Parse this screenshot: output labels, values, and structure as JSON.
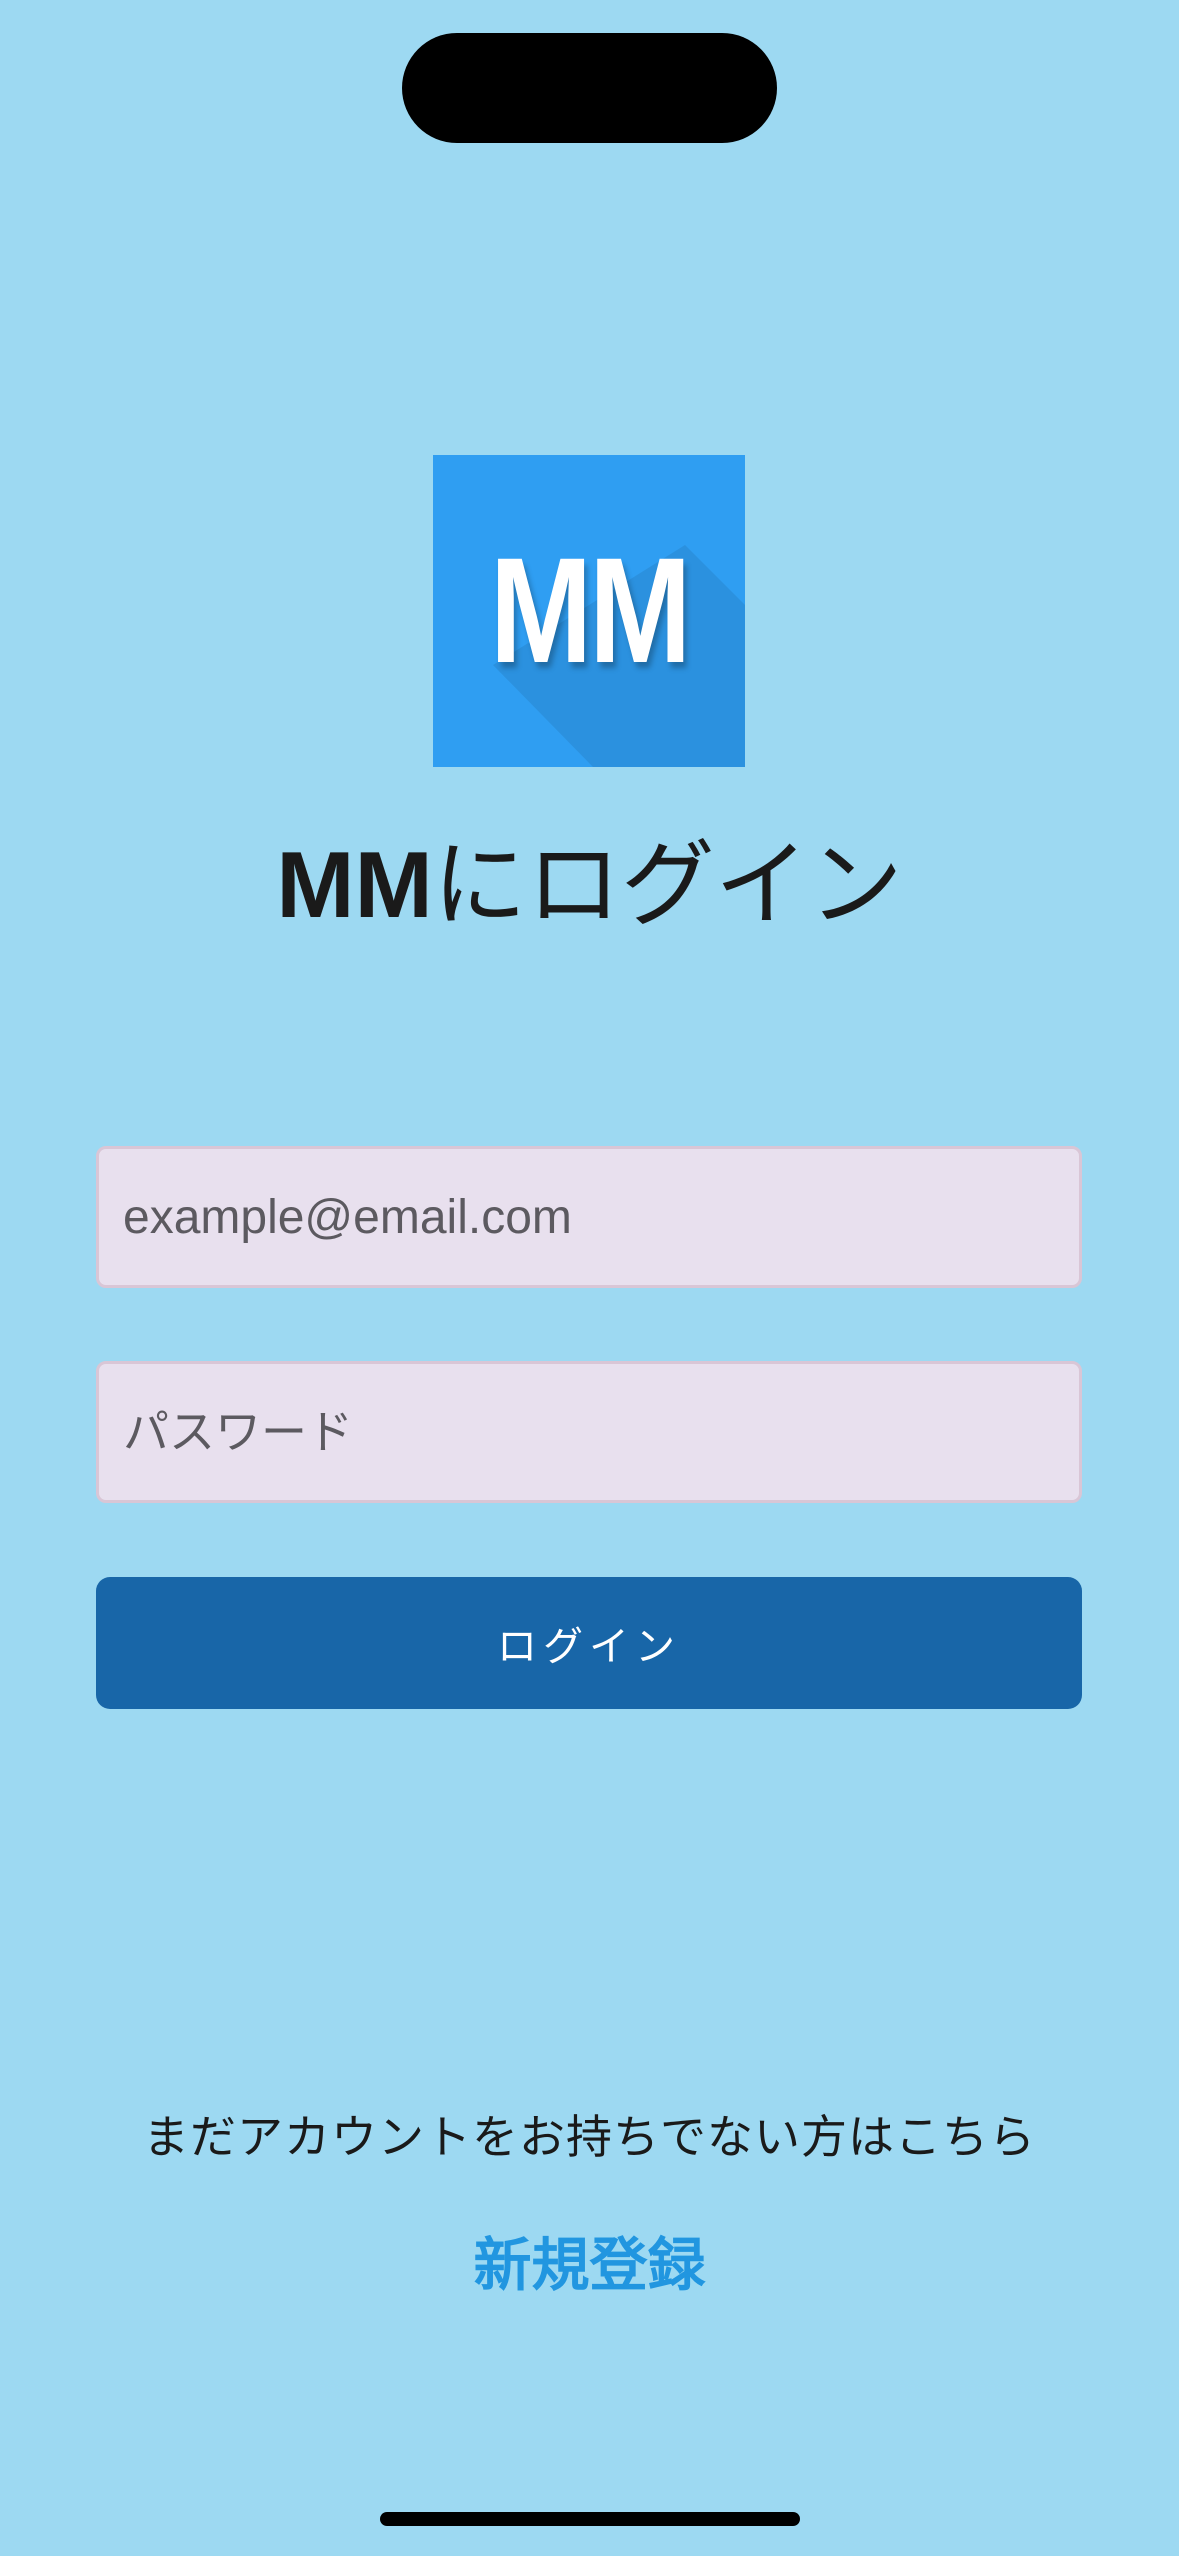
{
  "colors": {
    "background": "#9dd9f2",
    "logo_background": "#2f9ef2",
    "logo_text": "#ffffff",
    "field_background": "#e8e0ee",
    "primary_button": "#1866a8",
    "primary_button_text": "#ffffff",
    "link": "#2196e0"
  },
  "logo": {
    "text": "MM",
    "icon": "app-logo"
  },
  "header": {
    "title_bold": "MM",
    "title_rest": "にログイン"
  },
  "form": {
    "email": {
      "value": "",
      "placeholder": "example@email.com"
    },
    "password": {
      "value": "",
      "placeholder": "パスワード"
    },
    "login_label": "ログイン"
  },
  "footer": {
    "prompt": "まだアカウントをお持ちでない方はこちら",
    "signup_label": "新規登録"
  }
}
